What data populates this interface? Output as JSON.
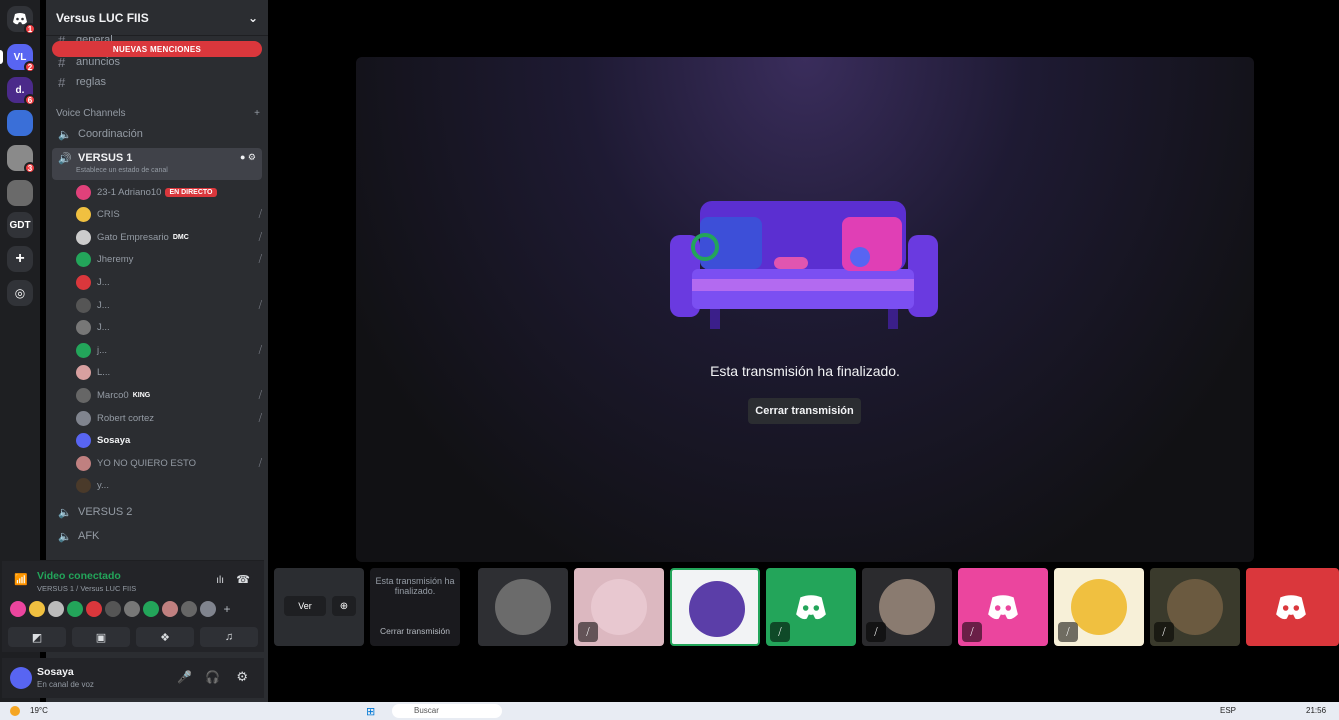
{
  "rail": {
    "gdt_label": "GDT",
    "vl_label": "VL",
    "home_badge": "1",
    "vl_badge": "2",
    "d_badge": "6",
    "img_badge": "3"
  },
  "guild": {
    "name": "Versus LUC FIIS",
    "mentions_banner": "NUEVAS MENCIONES",
    "text_channels": [
      "general",
      "anuncios",
      "reglas"
    ],
    "voice_category": "Voice Channels",
    "voice_channels": {
      "coordinacion": "Coordinación",
      "versus1": "VERSUS 1",
      "versus1_status": "Establece un estado de canal",
      "versus2": "VERSUS 2",
      "afk": "AFK"
    },
    "users": [
      {
        "name": "23-1 Adriano10",
        "live": "EN DIRECTO",
        "color": "#e0417a"
      },
      {
        "name": "CRIS",
        "color": "#f0c040"
      },
      {
        "name": "Gato Empresario",
        "tag": "DMC",
        "color": "#cccccc"
      },
      {
        "name": "Jheremy",
        "color": "#23a55a"
      },
      {
        "name": "J...",
        "color": "#da373c"
      },
      {
        "name": "J...",
        "color": "#555555"
      },
      {
        "name": "J...",
        "color": "#777777"
      },
      {
        "name": "j...",
        "color": "#23a55a"
      },
      {
        "name": "L...",
        "color": "#d8a0a0"
      },
      {
        "name": "Marco0",
        "tag": "KING",
        "color": "#666666"
      },
      {
        "name": "Robert cortez",
        "color": "#80848e"
      },
      {
        "name": "Sosaya",
        "color": "#5865f2"
      },
      {
        "name": "YO NO QUIERO ESTO",
        "color": "#c08080"
      },
      {
        "name": "y...",
        "color": "#4a3a2a"
      }
    ]
  },
  "voice": {
    "status": "Video conectado",
    "channel": "VERSUS 1 / Versus LUC FIIS"
  },
  "me": {
    "name": "Sosaya",
    "status": "En canal de voz"
  },
  "stage": {
    "ended_text": "Esta transmisión ha finalizado.",
    "close_button": "Cerrar transmisión"
  },
  "tiles": {
    "ver_label": "Ver",
    "mini_ended": "Esta transmisión ha finalizado.",
    "mini_close": "Cerrar transmisión"
  },
  "taskbar": {
    "temp": "19°C",
    "search": "Buscar",
    "lang": "ESP",
    "time": "21:56"
  },
  "colors": {
    "accent_green": "#23a55a",
    "discord_blurple": "#5865f2",
    "live_red": "#da373c",
    "tile_pink": "#eb459e"
  }
}
